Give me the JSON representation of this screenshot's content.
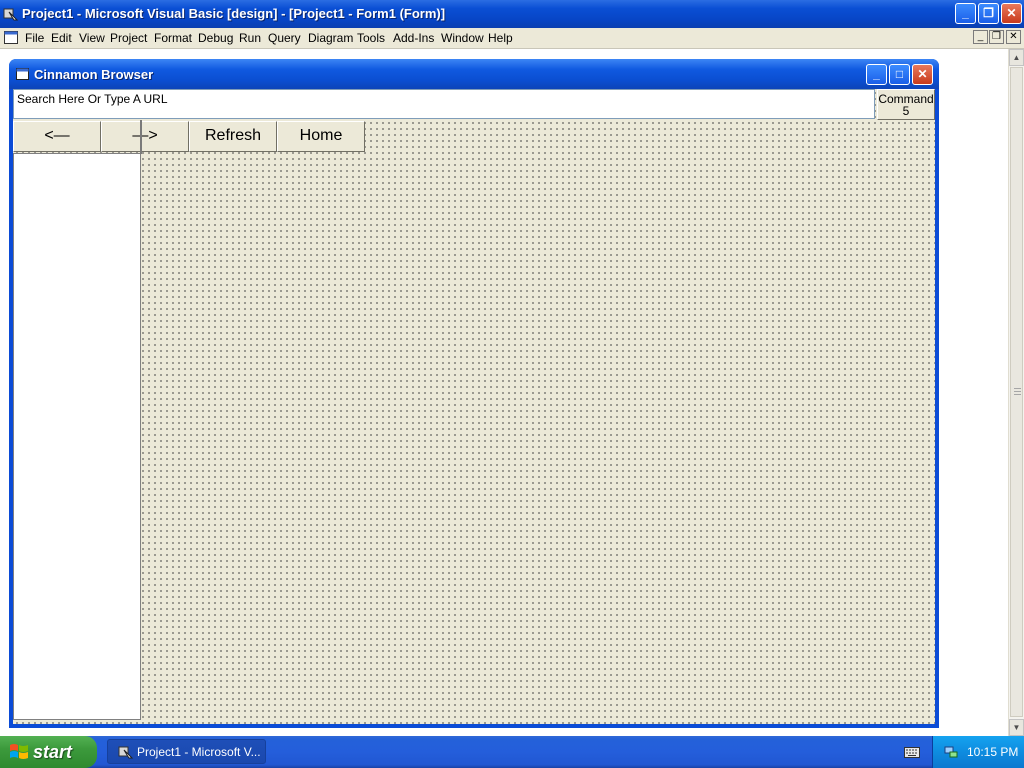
{
  "titlebar": {
    "title": "Project1 - Microsoft Visual Basic [design] - [Project1 - Form1 (Form)]",
    "minimize_glyph": "_",
    "maximize_glyph": "❐",
    "close_glyph": "✕"
  },
  "menubar": {
    "items": [
      "File",
      "Edit",
      "View",
      "Project",
      "Format",
      "Debug",
      "Run",
      "Query",
      "Diagram",
      "Tools",
      "Add-Ins",
      "Window",
      "Help"
    ],
    "mdi_minimize": "_",
    "mdi_restore": "❐",
    "mdi_close": "✕"
  },
  "form": {
    "title": "Cinnamon Browser",
    "minimize_glyph": "_",
    "maximize_glyph": "□",
    "close_glyph": "✕",
    "url_text": "Search Here Or Type A URL",
    "command5_line1": "Command",
    "command5_line2": "5",
    "back_label": "<—",
    "forward_label": "—>",
    "refresh_label": "Refresh",
    "home_label": "Home"
  },
  "taskbar": {
    "start_label": "start",
    "task_label": "Project1 - Microsoft V...",
    "clock": "10:15 PM"
  },
  "colors": {
    "title_blue": "#0a4fd4",
    "form_bg": "#ece9d8",
    "start_green": "#3c9a3c",
    "tray_blue": "#0e8ce0"
  }
}
